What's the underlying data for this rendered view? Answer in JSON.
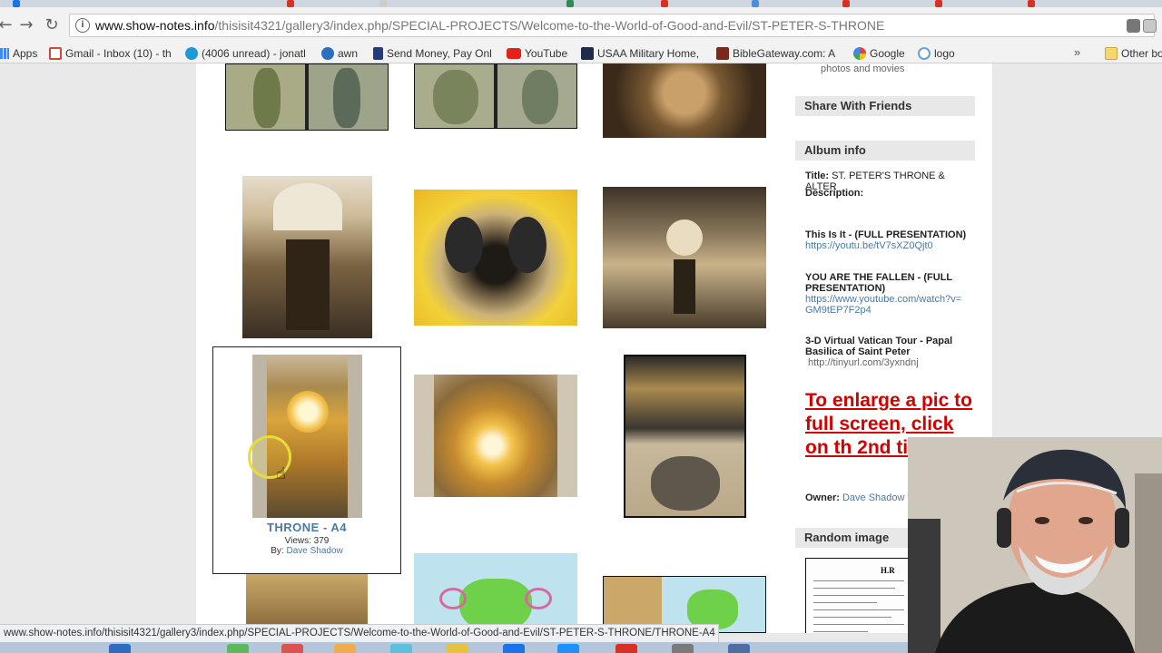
{
  "browser": {
    "url_domain": "www.show-notes.info",
    "url_path": "/thisisit4321/gallery3/index.php/SPECIAL-PROJECTS/Welcome-to-the-World-of-Good-and-Evil/ST-PETER-S-THRONE",
    "status_url": "www.show-notes.info/thisisit4321/gallery3/index.php/SPECIAL-PROJECTS/Welcome-to-the-World-of-Good-and-Evil/ST-PETER-S-THRONE/THRONE-A4",
    "bookmarks": [
      {
        "label": "Apps",
        "icon": "apps-grid-icon",
        "color": "#4285f4"
      },
      {
        "label": "Gmail - Inbox (10) - th",
        "icon": "gmail-icon",
        "color": "#d44638"
      },
      {
        "label": "(4006 unread) - jonatl",
        "icon": "att-globe-icon",
        "color": "#1d9ad6"
      },
      {
        "label": "awn",
        "icon": "awn-icon",
        "color": "#2a6fbf"
      },
      {
        "label": "Send Money, Pay Onl",
        "icon": "paypal-icon",
        "color": "#253b80"
      },
      {
        "label": "YouTube",
        "icon": "youtube-icon",
        "color": "#e62117"
      },
      {
        "label": "USAA Military Home,",
        "icon": "usaa-eagle-icon",
        "color": "#1f2b4a"
      },
      {
        "label": "BibleGateway.com: A",
        "icon": "biblegateway-icon",
        "color": "#7a2a1a"
      },
      {
        "label": "Google",
        "icon": "google-icon",
        "color": "#4285f4"
      },
      {
        "label": "logo",
        "icon": "globe-icon",
        "color": "#6aa0d8"
      }
    ],
    "other_bookmarks": "Other bo",
    "more_symbol": "»"
  },
  "gallery": {
    "selected_item": {
      "title": "THRONE - A4",
      "views": "Views: 379",
      "by_label": "By:",
      "by_name": "Dave Shadow"
    }
  },
  "sidebar": {
    "photos_and_movies": "photos and movies",
    "share_heading": "Share With Friends",
    "album_heading": "Album info",
    "title_label": "Title:",
    "title_value": "ST. PETER'S THRONE & ALTER",
    "description_label": "Description:",
    "links": [
      {
        "title": "This Is It - (FULL PRESENTATION)",
        "url": "https://youtu.be/tV7sXZ0Qjt0"
      },
      {
        "title": "YOU ARE THE FALLEN - (FULL PRESENTATION)",
        "url": "https://www.youtube.com/watch?v=GM9tEP7F2p4"
      },
      {
        "title": "3-D Virtual Vatican Tour - Papal Basilica of Saint Peter",
        "url": "http://tinyurl.com/3yxndnj"
      }
    ],
    "enlarge_text": "To enlarge a pic to full screen, click on th 2nd time.",
    "owner_label": "Owner:",
    "owner_name": "Dave Shadow",
    "random_heading": "Random image",
    "random_doc_heading": "H.R"
  },
  "colors": {
    "link": "#4a79a5",
    "enlarge_red": "#d40000",
    "sidebar_header_bg": "#e8e8e8"
  }
}
